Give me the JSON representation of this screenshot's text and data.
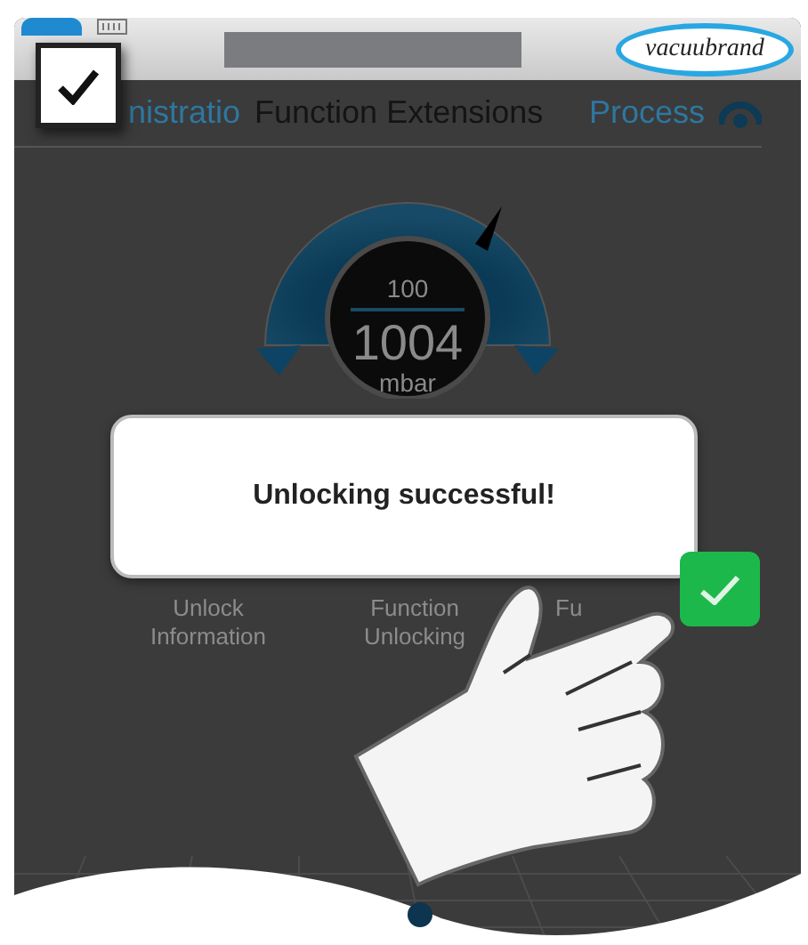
{
  "header": {
    "logo": "vacuubrand"
  },
  "step_marker": {
    "checked": true
  },
  "tabs": [
    {
      "label": "nistratio",
      "selected": false
    },
    {
      "label": "Function Extensions",
      "selected": true
    },
    {
      "label": "Process",
      "selected": false
    }
  ],
  "gauge": {
    "setpoint": "100",
    "value": "1004",
    "unit": "mbar"
  },
  "dialog": {
    "message": "Unlocking successful!"
  },
  "menu_items": [
    {
      "label": "Unlock Information"
    },
    {
      "label": "Function Unlocking"
    },
    {
      "label": "Fu"
    }
  ]
}
